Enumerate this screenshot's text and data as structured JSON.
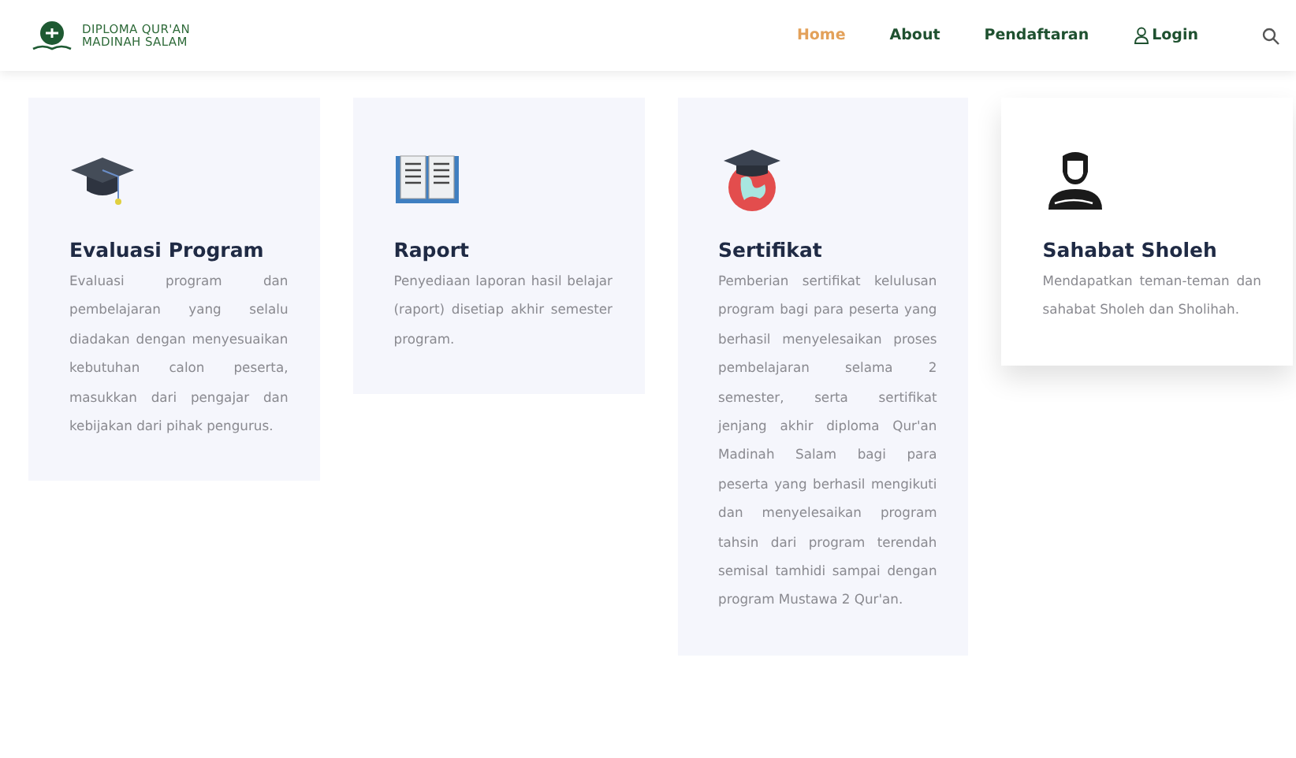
{
  "brand": {
    "line_1": "DIPLOMA QUR'AN",
    "line_2": "MADINAH SALAM"
  },
  "nav": [
    {
      "label": "Home",
      "selected": true,
      "kind": "text"
    },
    {
      "label": "About",
      "selected": false,
      "kind": "text"
    },
    {
      "label": "Pendaftaran",
      "selected": false,
      "kind": "text"
    },
    {
      "label": "Login",
      "selected": false,
      "kind": "user"
    }
  ],
  "cards": [
    {
      "kind": "cap",
      "title": "Evaluasi Program",
      "text": "Evaluasi program dan pembelajaran yang selalu diadakan dengan menyesuaikan kebutuhan calon peserta, masukkan dari pengajar dan kebijakan dari pihak pengurus.",
      "raised": false
    },
    {
      "kind": "book",
      "title": "Raport",
      "text": "Penyediaan laporan hasil belajar (raport) disetiap akhir semester program.",
      "raised": false
    },
    {
      "kind": "globe",
      "title": "Sertifikat",
      "text": "Pemberian sertifikat kelulusan program bagi para peserta yang berhasil menyelesaikan proses pembelajaran selama 2 semester, serta sertifikat jenjang akhir diploma Qur'an Madinah Salam bagi para peserta yang berhasil mengikuti dan menyelesaikan program tahsin dari program terendah semisal tamhidi sampai dengan program Mustawa 2 Qur'an.",
      "raised": false
    },
    {
      "kind": "person",
      "title": "Sahabat Sholeh",
      "text": "Mendapatkan teman-teman dan sahabat Sholeh dan Sholihah.",
      "raised": true
    }
  ]
}
